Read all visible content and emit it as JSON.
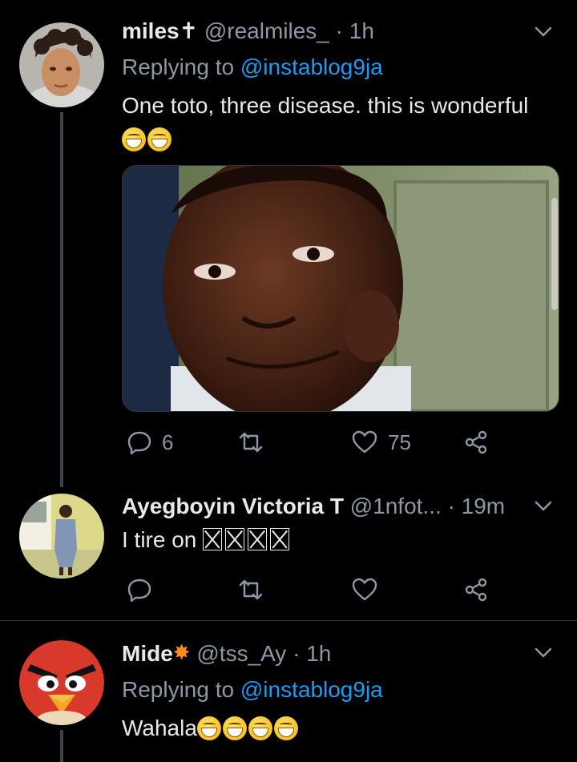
{
  "tweets": [
    {
      "name": "miles",
      "name_symbol": "✝",
      "handle": "@realmiles_",
      "time": "· 1h",
      "reply_prefix": "Replying to ",
      "reply_handle": "@instablog9ja",
      "text": "One toto, three disease. this is wonderful",
      "reply_count": "6",
      "retweet_count": "",
      "like_count": "75"
    },
    {
      "name": "Ayegboyin Victoria T",
      "handle": "@1nfot...",
      "time": "· 19m",
      "text": "I tire on "
    },
    {
      "name": "Mide",
      "handle": "@tss_Ay",
      "time": "· 1h",
      "reply_prefix": "Replying to ",
      "reply_handle": "@instablog9ja",
      "text": "Wahala"
    }
  ],
  "icons": {
    "reply": "reply-icon",
    "retweet": "retweet-icon",
    "like": "heart-icon",
    "share": "share-icon",
    "more": "chevron-down-icon"
  },
  "colors": {
    "background": "#000000",
    "link": "#1d9bf0",
    "secondary_text": "#8b98a5",
    "divider": "#2f3336"
  }
}
